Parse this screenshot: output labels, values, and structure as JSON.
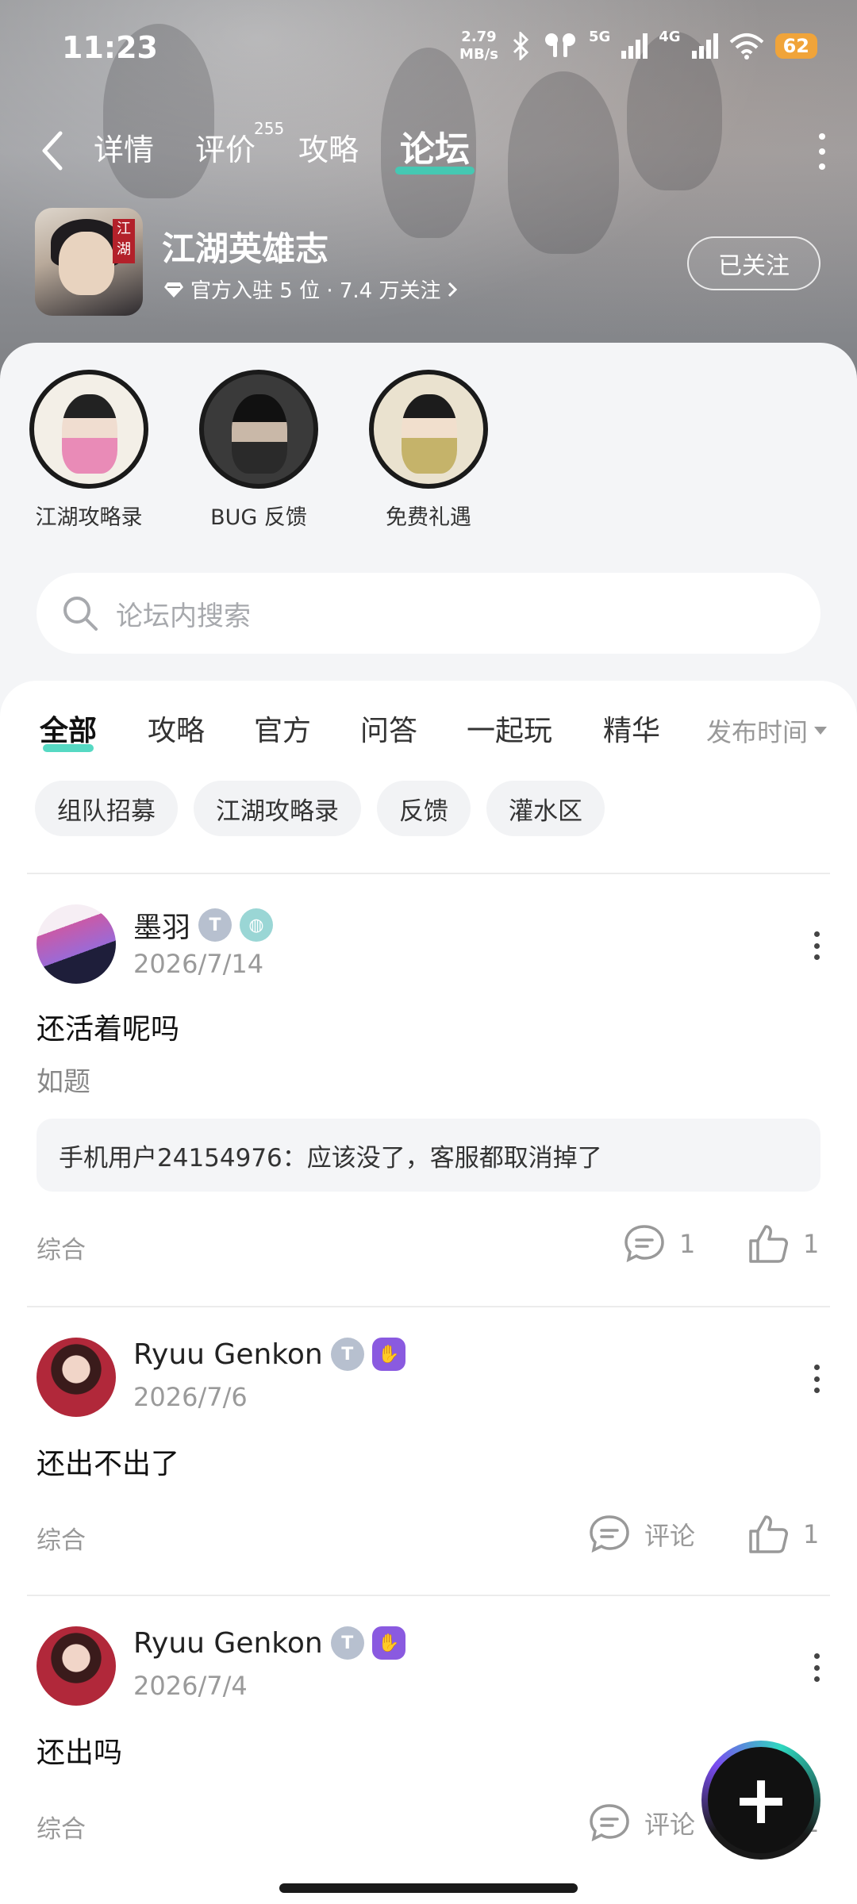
{
  "status_bar": {
    "time": "11:23",
    "net_speed_value": "2.79",
    "net_speed_unit": "MB/s",
    "sig1": "5G",
    "sig2": "4G",
    "battery": "62"
  },
  "nav": {
    "tabs": [
      "详情",
      "评价",
      "攻略",
      "论坛"
    ],
    "active_tab": "论坛",
    "review_count": "255"
  },
  "game": {
    "seal": "江湖",
    "title": "江湖英雄志",
    "meta": "官方入驻 5 位 · 7.4 万关注",
    "follow_label": "已关注"
  },
  "sections": [
    {
      "label": "江湖攻略录",
      "icon": "section-avatar-1"
    },
    {
      "label": "BUG 反馈",
      "icon": "section-avatar-2"
    },
    {
      "label": "免费礼遇",
      "icon": "section-avatar-3"
    }
  ],
  "search": {
    "placeholder": "论坛内搜索"
  },
  "categories": {
    "tabs": [
      "全部",
      "攻略",
      "官方",
      "问答",
      "一起玩",
      "精华"
    ],
    "active": "全部",
    "sort_label": "发布时间"
  },
  "chips": [
    "组队招募",
    "江湖攻略录",
    "反馈",
    "灌水区"
  ],
  "posts": [
    {
      "user": "墨羽",
      "date": "2026/7/14",
      "title": "还活着呢吗",
      "body": "如题",
      "reply": "手机用户24154976：应该没了，客服都取消掉了",
      "tag": "综合",
      "comment_label": "1",
      "like_label": "1"
    },
    {
      "user": "Ryuu Genkon",
      "date": "2026/7/6",
      "title": "还出不出了",
      "tag": "综合",
      "comment_label": "评论",
      "like_label": "1"
    },
    {
      "user": "Ryuu Genkon",
      "date": "2026/7/4",
      "title": "还出吗",
      "tag": "综合",
      "comment_label": "评论",
      "like_label": "1"
    }
  ],
  "fab": {
    "icon": "plus-icon"
  },
  "colors": {
    "accent": "#38d2b9",
    "battery": "#f0a43a",
    "purple_badge": "#8a5ae0"
  }
}
